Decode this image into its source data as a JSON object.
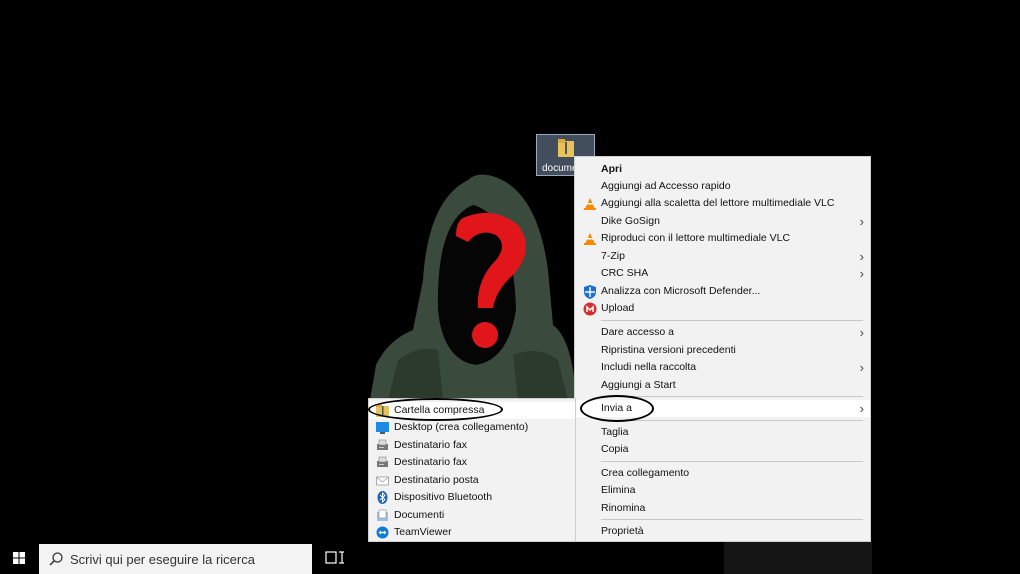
{
  "desktop": {
    "file_label": "docume"
  },
  "context_menu": {
    "items": [
      {
        "label": "Apri"
      },
      {
        "label": "Aggiungi ad Accesso rapido"
      },
      {
        "label": "Aggiungi alla scaletta del lettore multimediale VLC"
      },
      {
        "label": "Dike GoSign"
      },
      {
        "label": "Riproduci con il lettore multimediale VLC"
      },
      {
        "label": "7-Zip"
      },
      {
        "label": "CRC SHA"
      },
      {
        "label": "Analizza con Microsoft Defender..."
      },
      {
        "label": "Upload"
      },
      {
        "label": "Dare accesso a"
      },
      {
        "label": "Ripristina versioni precedenti"
      },
      {
        "label": "Includi nella raccolta"
      },
      {
        "label": "Aggiungi a Start"
      },
      {
        "label": "Invia a"
      },
      {
        "label": "Taglia"
      },
      {
        "label": "Copia"
      },
      {
        "label": "Crea collegamento"
      },
      {
        "label": "Elimina"
      },
      {
        "label": "Rinomina"
      },
      {
        "label": "Proprietà"
      }
    ]
  },
  "send_to_menu": {
    "items": [
      {
        "label": "Cartella compressa"
      },
      {
        "label": "Desktop (crea collegamento)"
      },
      {
        "label": "Destinatario fax"
      },
      {
        "label": "Destinatario fax"
      },
      {
        "label": "Destinatario posta"
      },
      {
        "label": "Dispositivo Bluetooth"
      },
      {
        "label": "Documenti"
      },
      {
        "label": "TeamViewer"
      }
    ]
  },
  "taskbar": {
    "search_placeholder": "Scrivi qui per eseguire la ricerca"
  },
  "colors": {
    "menu_bg": "#f2f2f2",
    "vlc_orange": "#f48b00",
    "defender_blue": "#1e6fd0",
    "upload_red": "#d32f2f",
    "question_red": "#e0161b"
  }
}
